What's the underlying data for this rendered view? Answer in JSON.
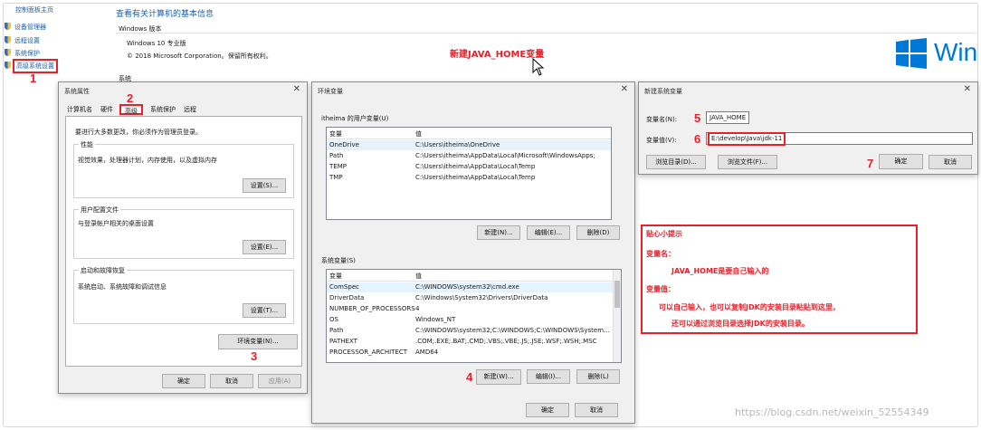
{
  "frame": {
    "watermark": "https://blog.csdn.net/weixin_52554349"
  },
  "nav": {
    "home": "控制面板主页",
    "items": [
      {
        "label": "设备管理器"
      },
      {
        "label": "远程设置"
      },
      {
        "label": "系统保护"
      },
      {
        "label": "高级系统设置"
      }
    ]
  },
  "system_page": {
    "heading": "查看有关计算机的基本信息",
    "edition_label": "Windows 版本",
    "edition": "Windows 10 专业版",
    "copyright": "© 2018 Microsoft Corporation。保留所有权利。",
    "system_label": "系统",
    "logo_text": "Win"
  },
  "callout_title": "新建JAVA_HOME变量",
  "markers": {
    "m1": "1",
    "m2": "2",
    "m3": "3",
    "m4": "4",
    "m5": "5",
    "m6": "6",
    "m7": "7"
  },
  "sysprops": {
    "title": "系统属性",
    "close": "✕",
    "tabs": [
      "计算机名",
      "硬件",
      "高级",
      "系统保护",
      "远程"
    ],
    "admin_note": "要进行大多数更改，你必须作为管理员登录。",
    "perf": {
      "title": "性能",
      "desc": "视觉效果，处理器计划，内存使用，以及虚拟内存",
      "button": "设置(S)..."
    },
    "profile": {
      "title": "用户配置文件",
      "desc": "与登录帐户相关的桌面设置",
      "button": "设置(E)..."
    },
    "startup": {
      "title": "启动和故障恢复",
      "desc": "系统启动、系统故障和调试信息",
      "button": "设置(T)..."
    },
    "env_button": "环境变量(N)...",
    "ok": "确定",
    "cancel": "取消",
    "apply": "应用(A)"
  },
  "envvars": {
    "title": "环境变量",
    "close": "✕",
    "user_group": "itheima 的用户变量(U)",
    "col_var": "变量",
    "col_val": "值",
    "user_vars": [
      {
        "name": "OneDrive",
        "value": "C:\\Users\\itheima\\OneDrive"
      },
      {
        "name": "Path",
        "value": "C:\\Users\\itheima\\AppData\\Local\\Microsoft\\WindowsApps;"
      },
      {
        "name": "TEMP",
        "value": "C:\\Users\\itheima\\AppData\\Local\\Temp"
      },
      {
        "name": "TMP",
        "value": "C:\\Users\\itheima\\AppData\\Local\\Temp"
      }
    ],
    "user_new": "新建(N)...",
    "user_edit": "编辑(E)...",
    "user_delete": "删除(D)",
    "sys_group": "系统变量(S)",
    "sys_vars": [
      {
        "name": "ComSpec",
        "value": "C:\\WINDOWS\\system32\\cmd.exe"
      },
      {
        "name": "DriverData",
        "value": "C:\\Windows\\System32\\Drivers\\DriverData"
      },
      {
        "name": "NUMBER_OF_PROCESSORS",
        "value": "4"
      },
      {
        "name": "OS",
        "value": "Windows_NT"
      },
      {
        "name": "Path",
        "value": "C:\\WINDOWS\\system32;C:\\WINDOWS;C:\\WINDOWS\\System..."
      },
      {
        "name": "PATHEXT",
        "value": ".COM;.EXE;.BAT;.CMD;.VBS;.VBE;.JS;.JSE;.WSF;.WSH;.MSC"
      },
      {
        "name": "PROCESSOR_ARCHITECT",
        "value": "AMD64"
      }
    ],
    "sys_new": "新建(W)...",
    "sys_edit": "编辑(I)...",
    "sys_delete": "删除(L)",
    "ok": "确定",
    "cancel": "取消"
  },
  "newvar": {
    "title": "新建系统变量",
    "close": "✕",
    "name_label": "变量名(N):",
    "name_value": "JAVA_HOME",
    "value_label": "变量值(V):",
    "value_value": "E:\\develop\\Java\\jdk-11",
    "browse_dir": "浏览目录(D)...",
    "browse_file": "浏览文件(F)...",
    "ok": "确定",
    "cancel": "取消"
  },
  "tips": {
    "title": "贴心小提示",
    "name_heading": "变量名：",
    "name_text": "JAVA_HOME是要自己输入的",
    "value_heading": "变量值：",
    "value_line1": "可以自己输入，也可以复制JDK的安装目录粘贴到这里，",
    "value_line2": "还可以通过浏览目录选择JDK的安装目录。"
  },
  "colors": {
    "accent_red": "#e8202a",
    "link_blue": "#1b5fae",
    "win_blue": "#0078d7"
  }
}
